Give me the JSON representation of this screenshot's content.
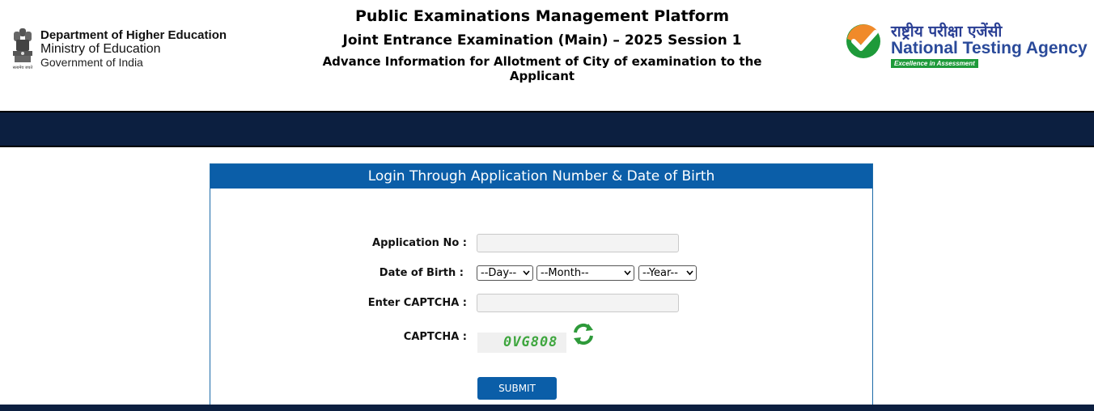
{
  "header": {
    "ministry": {
      "line1": "Department of Higher Education",
      "line2": "Ministry of Education",
      "line3": "Government of India",
      "motto": "सत्यमेव जयते"
    },
    "title": "Public Examinations Management Platform",
    "subtitle": "Joint Entrance Examination (Main) – 2025 Session 1",
    "description": "Advance Information for Allotment of City of examination to the Applicant",
    "agency": {
      "hindi_name": "राष्ट्रीय परीक्षा एजेंसी",
      "english_name": "National Testing Agency",
      "tagline": "Excellence in Assessment"
    }
  },
  "login": {
    "heading": "Login Through Application Number & Date of Birth",
    "application_no_label": "Application No :",
    "application_no_value": "",
    "dob_label": "Date of Birth :",
    "day_selected": "--Day--",
    "month_selected": "--Month--",
    "year_selected": "--Year--",
    "captcha_input_label": "Enter CAPTCHA :",
    "captcha_input_value": "",
    "captcha_label": "CAPTCHA :",
    "captcha_text": "0VG808",
    "refresh_icon": "refresh-icon",
    "submit_label": "SUBMIT"
  },
  "colors": {
    "primary": "#0b5ea8",
    "navband": "#0c1f40",
    "nta_blue": "#2a4a9a",
    "nta_green": "#1e9a3a",
    "captcha_green": "#3ea63e"
  }
}
